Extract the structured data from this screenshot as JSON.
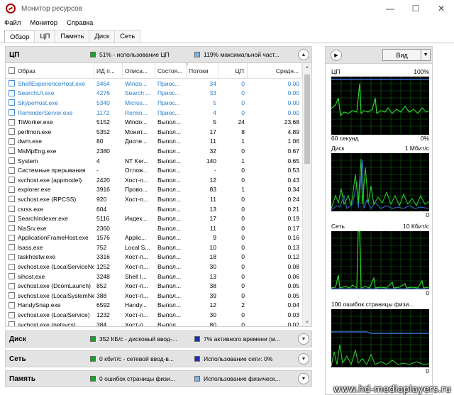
{
  "window": {
    "title": "Монитор ресурсов",
    "minimize": "—",
    "maximize": "☐",
    "close": "✕"
  },
  "menu": [
    "Файл",
    "Монитор",
    "Справка"
  ],
  "tabs": [
    "Обзор",
    "ЦП",
    "Память",
    "Диск",
    "Сеть"
  ],
  "cpu_section": {
    "title": "ЦП",
    "legend1": "51% - использование ЦП",
    "legend2": "119% максимальной част...",
    "legend1_color": "#1aa32a",
    "legend2_color": "#7fb2e5",
    "columns": [
      "Образ",
      "ИД п...",
      "Описа...",
      "Состоя...",
      "Потоки",
      "ЦП",
      "Средн..."
    ],
    "rows": [
      {
        "name": "ShellExperienceHost.exe",
        "pid": "3464",
        "desc": "Windo...",
        "state": "Приос...",
        "threads": "34",
        "cpu": "0",
        "avg": "0.00",
        "suspended": true
      },
      {
        "name": "SearchUI.exe",
        "pid": "4276",
        "desc": "Search ...",
        "state": "Приос...",
        "threads": "33",
        "cpu": "0",
        "avg": "0.00",
        "suspended": true
      },
      {
        "name": "SkypeHost.exe",
        "pid": "5340",
        "desc": "Micros...",
        "state": "Приос...",
        "threads": "5",
        "cpu": "0",
        "avg": "0.00",
        "suspended": true
      },
      {
        "name": "ReminderServer.exe",
        "pid": "1172",
        "desc": "Remin...",
        "state": "Приос...",
        "threads": "4",
        "cpu": "0",
        "avg": "0.00",
        "suspended": true
      },
      {
        "name": "TiWorker.exe",
        "pid": "5152",
        "desc": "Windo...",
        "state": "Выпол...",
        "threads": "5",
        "cpu": "24",
        "avg": "23.68",
        "suspended": false
      },
      {
        "name": "perfmon.exe",
        "pid": "5352",
        "desc": "Монит...",
        "state": "Выпол...",
        "threads": "17",
        "cpu": "8",
        "avg": "4.89",
        "suspended": false
      },
      {
        "name": "dwm.exe",
        "pid": "80",
        "desc": "Диспе...",
        "state": "Выпол...",
        "threads": "11",
        "cpu": "1",
        "avg": "1.06",
        "suspended": false
      },
      {
        "name": "MsMpEng.exe",
        "pid": "2380",
        "desc": "",
        "state": "Выпол...",
        "threads": "32",
        "cpu": "0",
        "avg": "0.67",
        "suspended": false
      },
      {
        "name": "System",
        "pid": "4",
        "desc": "NT Ker...",
        "state": "Выпол...",
        "threads": "140",
        "cpu": "1",
        "avg": "0.65",
        "suspended": false
      },
      {
        "name": "Системные прерывания",
        "pid": "-",
        "desc": "Отлож...",
        "state": "Выпол...",
        "threads": "-",
        "cpu": "0",
        "avg": "0.53",
        "suspended": false
      },
      {
        "name": "svchost.exe (appmodel)",
        "pid": "2420",
        "desc": "Хост-п...",
        "state": "Выпол...",
        "threads": "12",
        "cpu": "0",
        "avg": "0.43",
        "suspended": false
      },
      {
        "name": "explorer.exe",
        "pid": "3916",
        "desc": "Прово...",
        "state": "Выпол...",
        "threads": "83",
        "cpu": "1",
        "avg": "0.34",
        "suspended": false
      },
      {
        "name": "svchost.exe (RPCSS)",
        "pid": "920",
        "desc": "Хост-п...",
        "state": "Выпол...",
        "threads": "11",
        "cpu": "0",
        "avg": "0.24",
        "suspended": false
      },
      {
        "name": "csrss.exe",
        "pid": "604",
        "desc": "",
        "state": "Выпол...",
        "threads": "13",
        "cpu": "0",
        "avg": "0.21",
        "suspended": false
      },
      {
        "name": "SearchIndexer.exe",
        "pid": "5116",
        "desc": "Индек...",
        "state": "Выпол...",
        "threads": "17",
        "cpu": "0",
        "avg": "0.19",
        "suspended": false
      },
      {
        "name": "NisSrv.exe",
        "pid": "2360",
        "desc": "",
        "state": "Выпол...",
        "threads": "11",
        "cpu": "0",
        "avg": "0.17",
        "suspended": false
      },
      {
        "name": "ApplicationFrameHost.exe",
        "pid": "1576",
        "desc": "Applic...",
        "state": "Выпол...",
        "threads": "9",
        "cpu": "0",
        "avg": "0.16",
        "suspended": false
      },
      {
        "name": "lsass.exe",
        "pid": "752",
        "desc": "Local S...",
        "state": "Выпол...",
        "threads": "10",
        "cpu": "0",
        "avg": "0.13",
        "suspended": false
      },
      {
        "name": "taskhostw.exe",
        "pid": "3316",
        "desc": "Хост-п...",
        "state": "Выпол...",
        "threads": "18",
        "cpu": "0",
        "avg": "0.12",
        "suspended": false
      },
      {
        "name": "svchost.exe (LocalServiceNo...",
        "pid": "1252",
        "desc": "Хост-п...",
        "state": "Выпол...",
        "threads": "30",
        "cpu": "0",
        "avg": "0.08",
        "suspended": false
      },
      {
        "name": "sihost.exe",
        "pid": "3248",
        "desc": "Shell I...",
        "state": "Выпол...",
        "threads": "13",
        "cpu": "0",
        "avg": "0.06",
        "suspended": false
      },
      {
        "name": "svchost.exe (DcomLaunch)",
        "pid": "852",
        "desc": "Хост-п...",
        "state": "Выпол...",
        "threads": "38",
        "cpu": "0",
        "avg": "0.05",
        "suspended": false
      },
      {
        "name": "svchost.exe (LocalSystemNet...",
        "pid": "388",
        "desc": "Хост-п...",
        "state": "Выпол...",
        "threads": "39",
        "cpu": "0",
        "avg": "0.05",
        "suspended": false
      },
      {
        "name": "HandySnap.exe",
        "pid": "6592",
        "desc": "Handy...",
        "state": "Выпол...",
        "threads": "12",
        "cpu": "2",
        "avg": "0.04",
        "suspended": false
      },
      {
        "name": "svchost.exe (LocalService)",
        "pid": "1232",
        "desc": "Хост-п...",
        "state": "Выпол...",
        "threads": "30",
        "cpu": "0",
        "avg": "0.03",
        "suspended": false
      },
      {
        "name": "svchost.exe (netsvcs)",
        "pid": "384",
        "desc": "Хост-п...",
        "state": "Выпол...",
        "threads": "80",
        "cpu": "0",
        "avg": "0.02",
        "suspended": false
      }
    ]
  },
  "disk_section": {
    "title": "Диск",
    "legend1": "352 КБ/с - дисковый ввод-...",
    "legend2": "7% активного времени (м...",
    "legend1_color": "#1aa32a",
    "legend2_color": "#1a2fb3"
  },
  "net_section": {
    "title": "Сеть",
    "legend1": "0 кбит/с - сетевой ввод-в...",
    "legend2": "Использование сети: 0%",
    "legend1_color": "#1aa32a",
    "legend2_color": "#1a2fb3"
  },
  "mem_section": {
    "title": "Память",
    "legend1": "0 ошибок страницы физи...",
    "legend2": "Использование физическ...",
    "legend1_color": "#1aa32a",
    "legend2_color": "#7fb2e5"
  },
  "right_panel": {
    "view_label": "Вид",
    "cpu_graph": {
      "label": "ЦП",
      "max": "100%",
      "time": "60 секунд",
      "min": "0%"
    },
    "disk_graph": {
      "label": "Диск",
      "max": "1 Мбит/с",
      "min": "0"
    },
    "net_graph": {
      "label": "Сеть",
      "max": "10 Кбит/с",
      "min": "0"
    },
    "mem_graph": {
      "label": "100 ошибок страницы физи...",
      "min": "0"
    }
  },
  "watermark": "www.hd-mediaplayers.ru"
}
